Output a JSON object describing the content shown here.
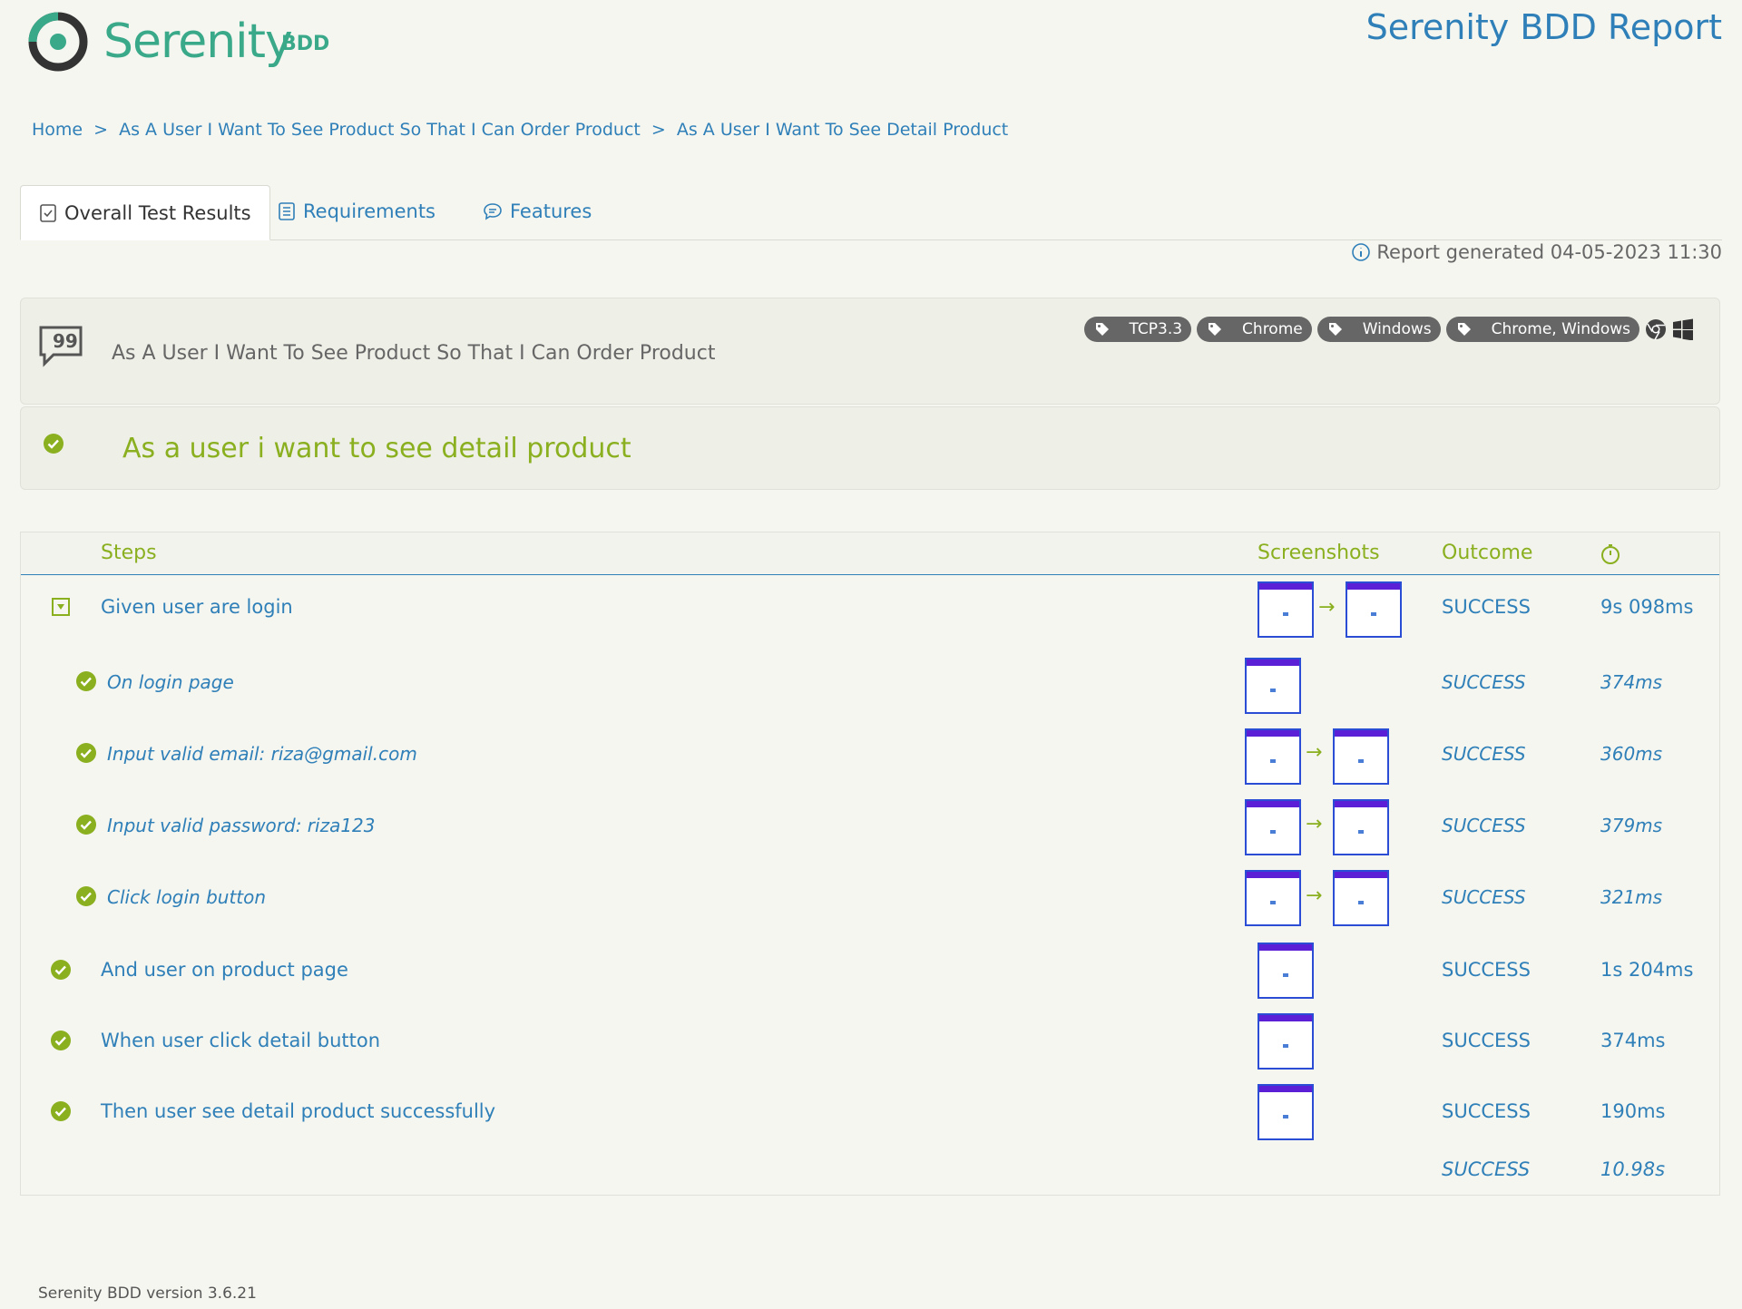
{
  "header": {
    "logo_text": "Serenity",
    "logo_suffix": "BDD",
    "report_title": "Serenity BDD Report"
  },
  "breadcrumb": {
    "items": [
      "Home",
      "As A User I Want To See Product So That I Can Order Product",
      "As A User I Want To See Detail Product"
    ],
    "separator": ">"
  },
  "tabs": [
    {
      "label": "Overall Test Results",
      "icon": "checklist-icon",
      "active": true
    },
    {
      "label": "Requirements",
      "icon": "requirements-icon",
      "active": false
    },
    {
      "label": "Features",
      "icon": "chat-icon",
      "active": false
    }
  ],
  "report_generated": "Report generated 04-05-2023 11:30",
  "feature": {
    "title": "As A User I Want To See Product So That I Can Order Product",
    "tags": [
      "TCP3.3",
      "Chrome",
      "Windows",
      "Chrome, Windows"
    ]
  },
  "scenario": {
    "title": "As a user i want to see detail product"
  },
  "steps_table": {
    "headers": {
      "steps": "Steps",
      "screenshots": "Screenshots",
      "outcome": "Outcome",
      "duration_icon": "stopwatch-icon"
    },
    "rows": [
      {
        "text": "Given user are login",
        "outcome": "SUCCESS",
        "duration": "9s 098ms"
      },
      {
        "text": "On login page",
        "outcome": "SUCCESS",
        "duration": "374ms"
      },
      {
        "text": "Input valid email: riza@gmail.com",
        "outcome": "SUCCESS",
        "duration": "360ms"
      },
      {
        "text": "Input valid password: riza123",
        "outcome": "SUCCESS",
        "duration": "379ms"
      },
      {
        "text": "Click login button",
        "outcome": "SUCCESS",
        "duration": "321ms"
      },
      {
        "text": "And user on product page",
        "outcome": "SUCCESS",
        "duration": "1s 204ms"
      },
      {
        "text": "When user click detail button",
        "outcome": "SUCCESS",
        "duration": "374ms"
      },
      {
        "text": "Then user see detail product successfully",
        "outcome": "SUCCESS",
        "duration": "190ms"
      }
    ],
    "total": {
      "outcome": "SUCCESS",
      "duration": "10.98s"
    }
  },
  "footer": "Serenity BDD version 3.6.21",
  "colors": {
    "accent_blue": "#2f7fb8",
    "success_green": "#8aaf1f",
    "brand_teal": "#3aa98a",
    "background": "#f5f6f0"
  }
}
